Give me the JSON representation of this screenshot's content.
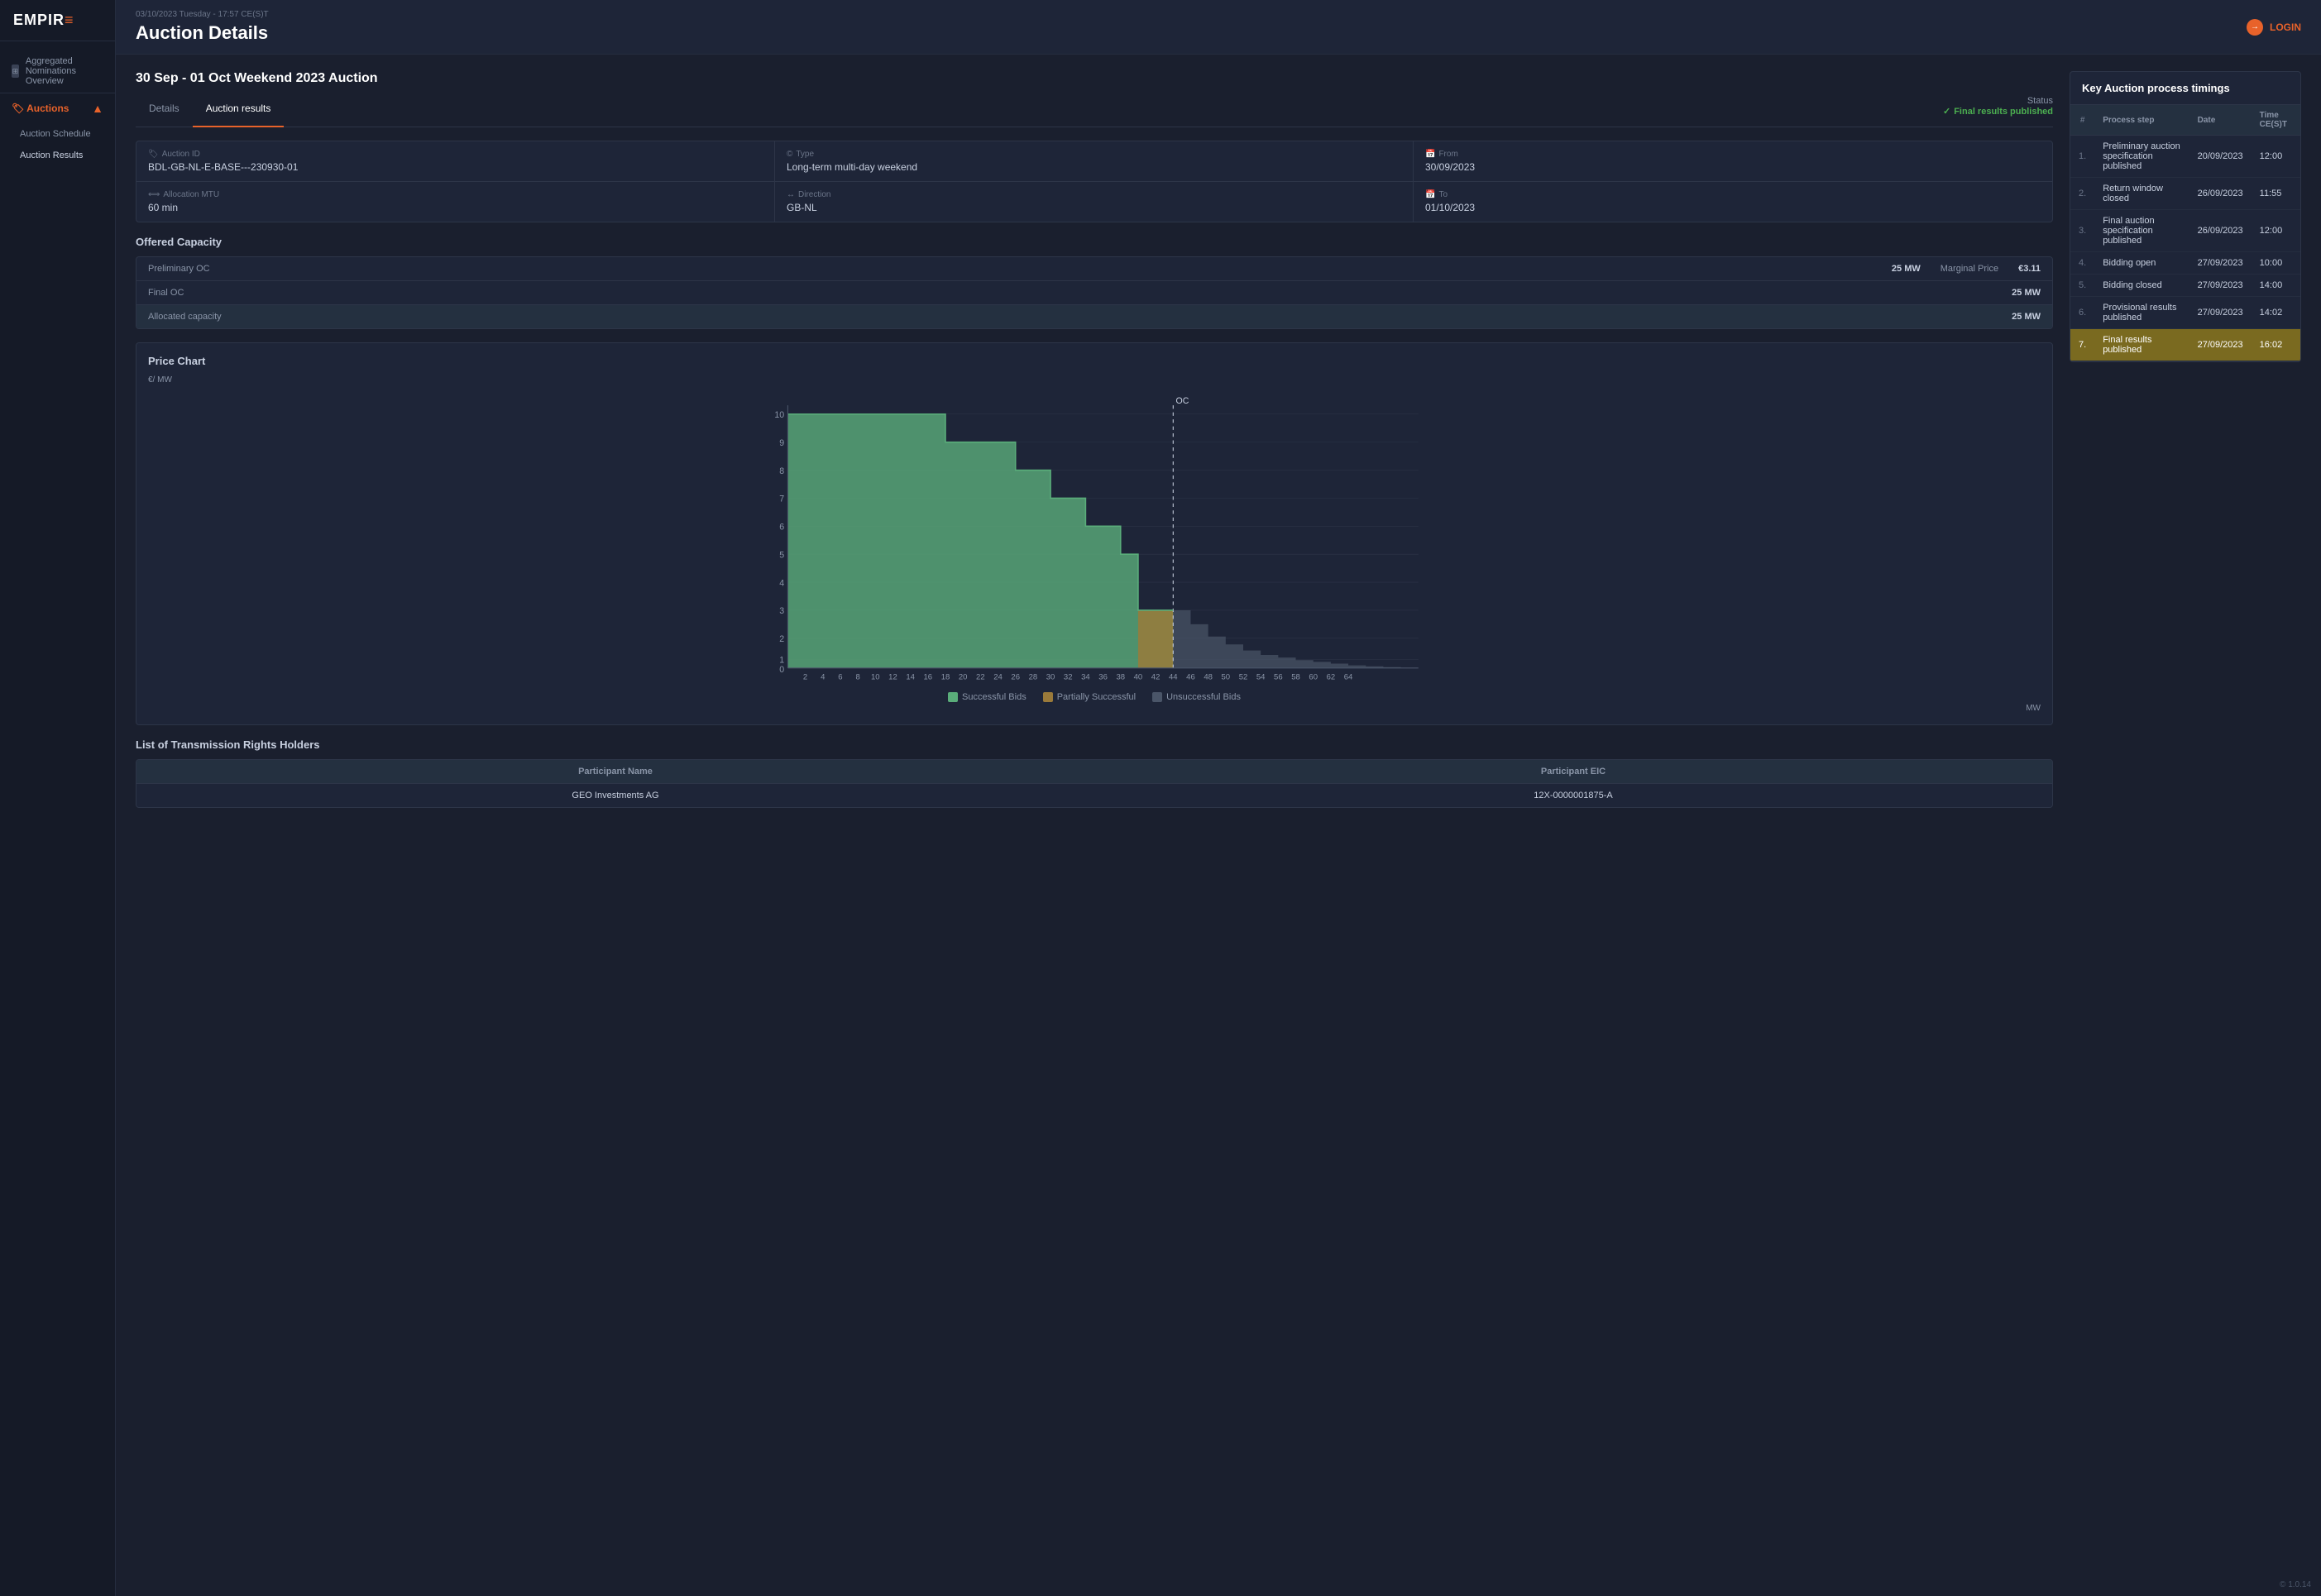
{
  "app": {
    "logo": "EMPIR",
    "logo_accent": "E",
    "version": "1.0.14",
    "timestamp": "03/10/2023 Tuesday - 17:57 CE(S)T",
    "page_title": "Auction Details",
    "login_label": "LOGIN"
  },
  "sidebar": {
    "nav_item": {
      "label": "Aggregated Nominations Overview",
      "icon": "grid-icon"
    },
    "group": {
      "label": "Auctions",
      "items": [
        {
          "label": "Auction Schedule",
          "active": false
        },
        {
          "label": "Auction Results",
          "active": true
        }
      ]
    }
  },
  "auction": {
    "title": "30 Sep - 01 Oct Weekend 2023 Auction",
    "tabs": [
      {
        "label": "Details",
        "active": false
      },
      {
        "label": "Auction results",
        "active": true
      }
    ],
    "status": {
      "label": "Status",
      "value": "Final results published",
      "icon": "check-icon"
    },
    "fields": {
      "auction_id_label": "Auction ID",
      "auction_id_value": "BDL-GB-NL-E-BASE---230930-01",
      "type_label": "Type",
      "type_value": "Long-term multi-day weekend",
      "from_label": "From",
      "from_value": "30/09/2023",
      "allocation_mtu_label": "Allocation MTU",
      "allocation_mtu_value": "60 min",
      "direction_label": "Direction",
      "direction_value": "GB-NL",
      "to_label": "To",
      "to_value": "01/10/2023"
    },
    "offered_capacity": {
      "title": "Offered Capacity",
      "rows": [
        {
          "label": "Preliminary OC",
          "value": "25 MW"
        },
        {
          "label": "Final OC",
          "value": "25 MW"
        },
        {
          "label": "Allocated capacity",
          "value": "25 MW"
        }
      ],
      "marginal_price_label": "Marginal Price",
      "marginal_price_value": "€3.11"
    },
    "price_chart": {
      "title": "Price Chart",
      "y_axis_label": "€/ MW",
      "x_axis_label": "MW",
      "oc_label": "OC",
      "y_ticks": [
        "10",
        "9",
        "8",
        "7",
        "6",
        "5",
        "4",
        "3",
        "2",
        "1",
        "0"
      ],
      "x_ticks": [
        "2",
        "4",
        "6",
        "8",
        "10",
        "12",
        "14",
        "16",
        "18",
        "20",
        "22",
        "24",
        "26",
        "28",
        "30",
        "32",
        "34",
        "36",
        "38",
        "40",
        "42",
        "44",
        "46",
        "48",
        "50",
        "52",
        "54",
        "56",
        "58",
        "60",
        "62",
        "64"
      ]
    },
    "legend": [
      {
        "label": "Successful Bids",
        "color": "#5aad7a"
      },
      {
        "label": "Partially Successful",
        "color": "#9a7a3a"
      },
      {
        "label": "Unsuccessful Bids",
        "color": "#4a5568"
      }
    ],
    "transmission_rights": {
      "title": "List of Transmission Rights Holders",
      "headers": [
        "Participant Name",
        "Participant EIC"
      ],
      "rows": [
        {
          "name": "GEO Investments AG",
          "eic": "12X-0000001875-A"
        }
      ]
    }
  },
  "timings": {
    "title": "Key Auction process timings",
    "columns": [
      "#",
      "Process step",
      "Date",
      "Time CE(S)T"
    ],
    "rows": [
      {
        "num": "1.",
        "step": "Preliminary auction specification published",
        "date": "20/09/2023",
        "time": "12:00",
        "highlighted": false
      },
      {
        "num": "2.",
        "step": "Return window closed",
        "date": "26/09/2023",
        "time": "11:55",
        "highlighted": false
      },
      {
        "num": "3.",
        "step": "Final auction specification published",
        "date": "26/09/2023",
        "time": "12:00",
        "highlighted": false
      },
      {
        "num": "4.",
        "step": "Bidding open",
        "date": "27/09/2023",
        "time": "10:00",
        "highlighted": false
      },
      {
        "num": "5.",
        "step": "Bidding closed",
        "date": "27/09/2023",
        "time": "14:00",
        "highlighted": false
      },
      {
        "num": "6.",
        "step": "Provisional results published",
        "date": "27/09/2023",
        "time": "14:02",
        "highlighted": false
      },
      {
        "num": "7.",
        "step": "Final results published",
        "date": "27/09/2023",
        "time": "16:02",
        "highlighted": true
      }
    ]
  }
}
